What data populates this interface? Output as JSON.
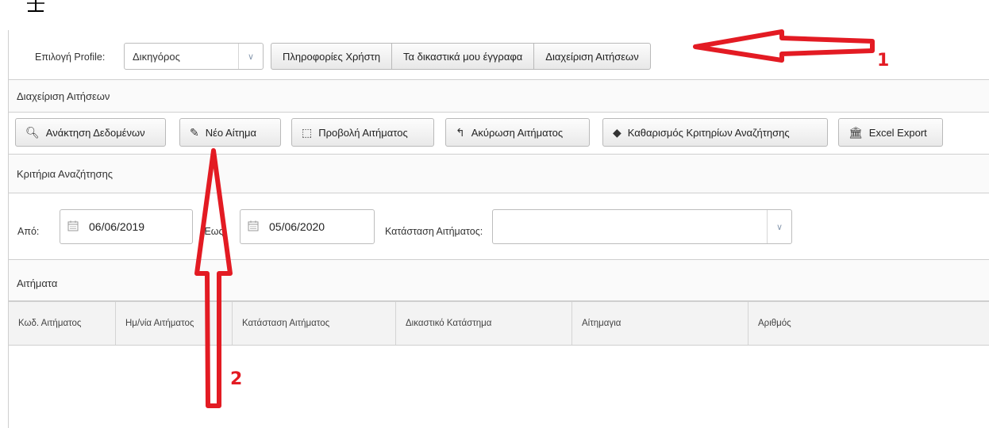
{
  "header": {
    "profile_label": "Επιλογή Profile:",
    "profile_value": "Δικηγόρος",
    "tabs": [
      "Πληροφορίες Χρήστη",
      "Τα δικαστικά μου έγγραφα",
      "Διαχείριση Αιτήσεων"
    ]
  },
  "section": {
    "title": "Διαχείριση Αιτήσεων"
  },
  "toolbar": {
    "buttons": [
      {
        "label": "Ανάκτηση Δεδομένων",
        "icon": "search-icon"
      },
      {
        "label": "Νέο Αίτημα",
        "icon": "edit-icon"
      },
      {
        "label": "Προβολή Αιτήματος",
        "icon": "view-icon"
      },
      {
        "label": "Ακύρωση Αιτήματος",
        "icon": "undo-icon"
      },
      {
        "label": "Καθαρισμός Κριτηρίων Αναζήτησης",
        "icon": "eraser-icon"
      },
      {
        "label": "Excel Export",
        "icon": "excel-icon"
      }
    ]
  },
  "criteria": {
    "title": "Κριτήρια Αναζήτησης",
    "from_label": "Από:",
    "from_value": "06/06/2019",
    "to_label": "Έως:",
    "to_value": "05/06/2020",
    "status_label": "Κατάσταση Αιτήματος:",
    "status_value": ""
  },
  "requests": {
    "title": "Αιτήματα",
    "columns": [
      "Κωδ. Αιτήματος",
      "Ημ/νία Αιτήματος",
      "Κατάσταση Αιτήματος",
      "Δικαστικό Κατάστημα",
      "Αίτημαγια",
      "Αριθμός"
    ]
  },
  "annotations": {
    "arrow1": "1",
    "arrow2": "2"
  },
  "colors": {
    "annotation": "#e31b23"
  }
}
